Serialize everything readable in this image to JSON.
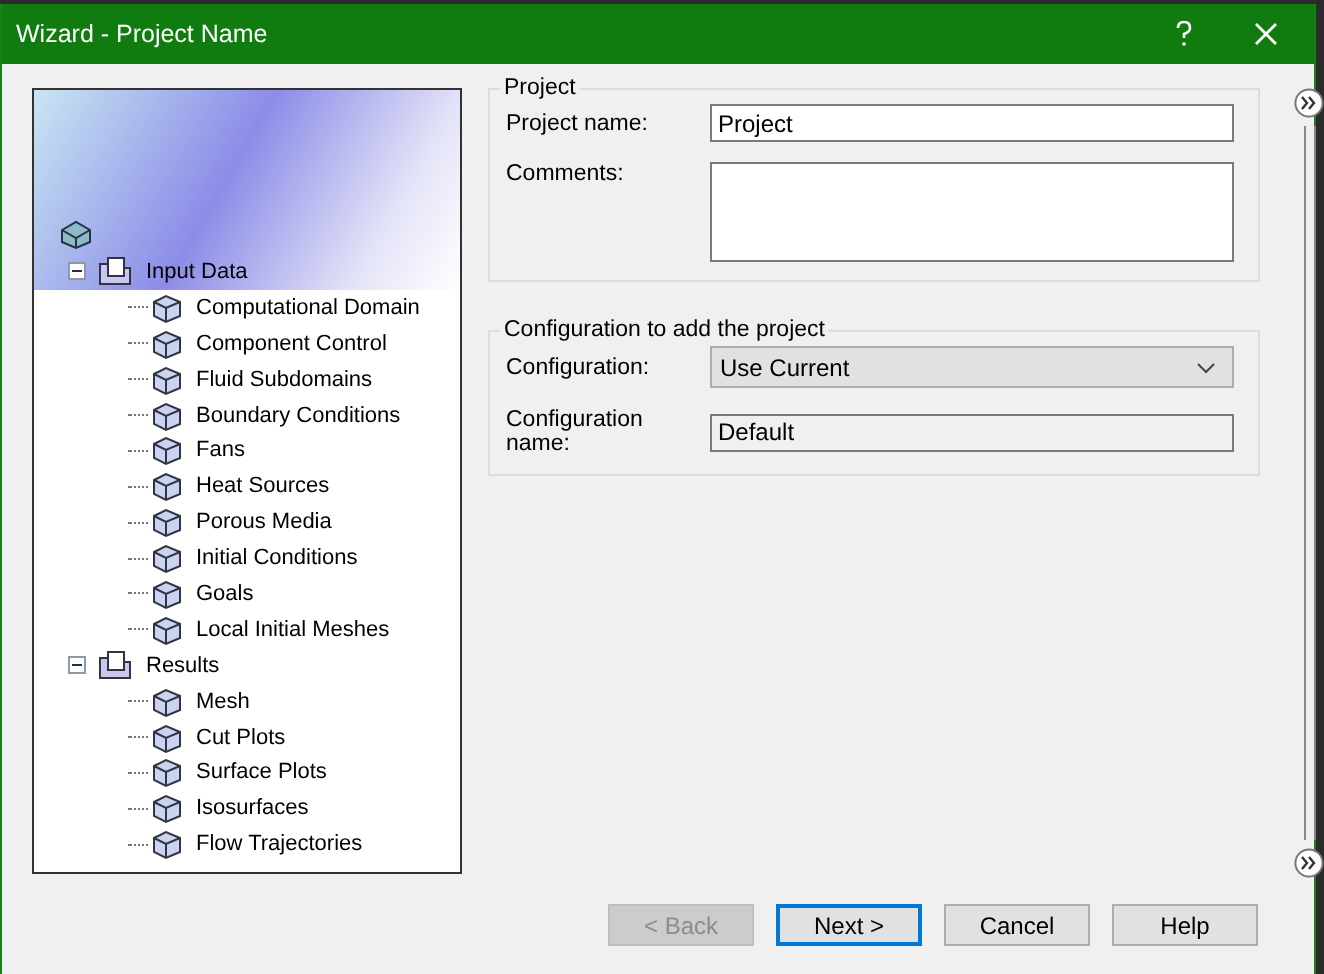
{
  "window": {
    "title": "Wizard - Project Name"
  },
  "tree": [
    {
      "label": "Input Data",
      "expanded": true,
      "children": [
        {
          "label": "Computational Domain"
        },
        {
          "label": "Component Control"
        },
        {
          "label": "Fluid Subdomains"
        },
        {
          "label": "Boundary Conditions"
        },
        {
          "label": "Fans"
        },
        {
          "label": "Heat Sources"
        },
        {
          "label": "Porous Media"
        },
        {
          "label": "Initial Conditions"
        },
        {
          "label": "Goals"
        },
        {
          "label": "Local Initial Meshes"
        }
      ]
    },
    {
      "label": "Results",
      "expanded": true,
      "children": [
        {
          "label": "Mesh"
        },
        {
          "label": "Cut Plots"
        },
        {
          "label": "Surface Plots"
        },
        {
          "label": "Isosurfaces"
        },
        {
          "label": "Flow Trajectories"
        }
      ]
    }
  ],
  "project_group": {
    "title": "Project",
    "name_label": "Project name:",
    "name_value": "Project",
    "comments_label": "Comments:"
  },
  "configuration_group": {
    "title": "Configuration to add the project",
    "configuration_label": "Configuration:",
    "configuration_value": "Use Current",
    "name_label": "Configuration name:",
    "name_value": "Default"
  },
  "buttons": [
    {
      "label": "< Back",
      "disabled": true,
      "selected": false
    },
    {
      "label": "Next >",
      "disabled": false,
      "selected": true
    },
    {
      "label": "Cancel",
      "disabled": false,
      "selected": false
    },
    {
      "label": "Help",
      "disabled": false,
      "selected": false
    }
  ]
}
